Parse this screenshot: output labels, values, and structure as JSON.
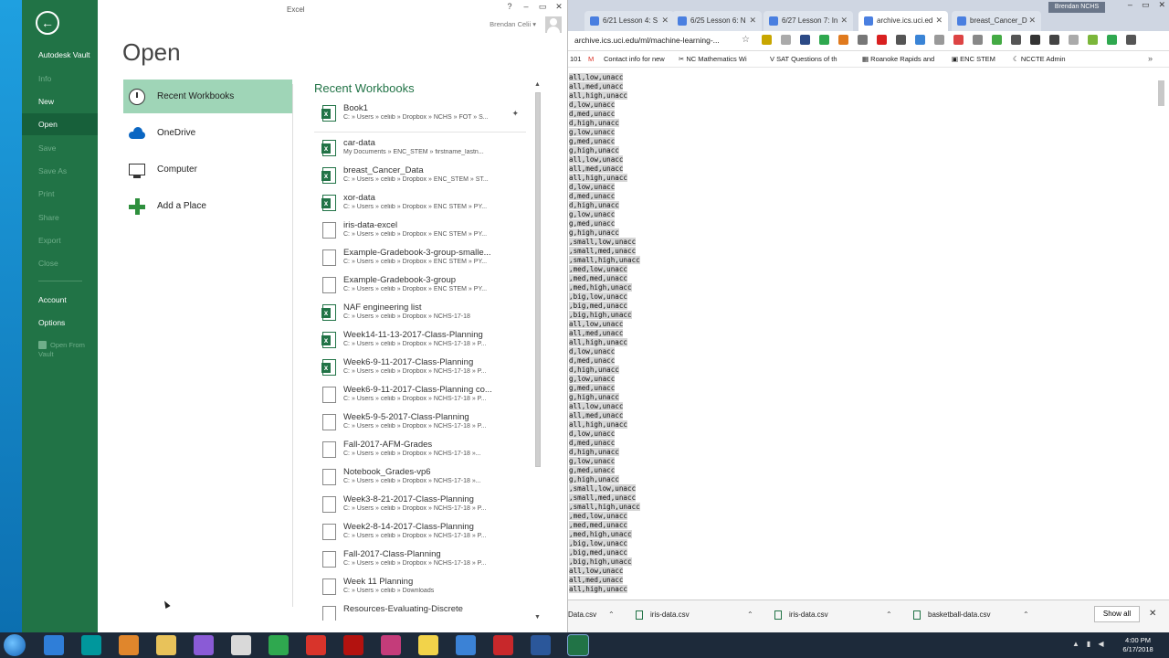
{
  "excel": {
    "title": "Excel",
    "controls": {
      "help": "?",
      "minimize": "–",
      "restore": "▭",
      "close": "✕"
    },
    "user_name": "Brendan Celii ▾",
    "back": "←",
    "nav": {
      "autodesk_vault": "Autodesk Vault",
      "info": "Info",
      "new": "New",
      "open": "Open",
      "save": "Save",
      "save_as": "Save As",
      "print": "Print",
      "share": "Share",
      "export": "Export",
      "close": "Close",
      "account": "Account",
      "options": "Options",
      "open_from_vault": "Open From Vault"
    },
    "page_title": "Open",
    "places": [
      {
        "label": "Recent Workbooks",
        "icon": "clock-icon"
      },
      {
        "label": "OneDrive",
        "icon": "cloud-icon"
      },
      {
        "label": "Computer",
        "icon": "computer-icon"
      },
      {
        "label": "Add a Place",
        "icon": "plus-icon"
      }
    ],
    "recent_title": "Recent Workbooks",
    "pin": "✦",
    "recent_files": [
      {
        "name": "Book1",
        "path": "C: » Users » celiib » Dropbox » NCHS » FOT » S...",
        "icon": "excel-file-icon"
      },
      {
        "name": "car-data",
        "path": "My Documents » ENC_STEM » firstname_lastn...",
        "icon": "excel-file-icon"
      },
      {
        "name": "breast_Cancer_Data",
        "path": "C: » Users » celiib » Dropbox » ENC_STEM » ST...",
        "icon": "excel-file-icon"
      },
      {
        "name": "xor-data",
        "path": "C: » Users » celiib » Dropbox » ENC STEM » PY...",
        "icon": "excel-file-icon"
      },
      {
        "name": "iris-data-excel",
        "path": "C: » Users » celiib » Dropbox » ENC STEM » PY...",
        "icon": "doc-file-icon"
      },
      {
        "name": "Example-Gradebook-3-group-smalle...",
        "path": "C: » Users » celiib » Dropbox » ENC STEM » PY...",
        "icon": "doc-file-icon"
      },
      {
        "name": "Example-Gradebook-3-group",
        "path": "C: » Users » celiib » Dropbox » ENC STEM » PY...",
        "icon": "doc-file-icon"
      },
      {
        "name": "NAF engineering list",
        "path": "C: » Users » celiib » Dropbox » NCHS-17-18",
        "icon": "excel-file-icon"
      },
      {
        "name": "Week14-11-13-2017-Class-Planning",
        "path": "C: » Users » celiib » Dropbox » NCHS-17-18 » P...",
        "icon": "excel-file-icon"
      },
      {
        "name": "Week6-9-11-2017-Class-Planning",
        "path": "C: » Users » celiib » Dropbox » NCHS-17-18 » P...",
        "icon": "excel-file-icon"
      },
      {
        "name": "Week6-9-11-2017-Class-Planning co...",
        "path": "C: » Users » celiib » Dropbox » NCHS-17-18 » P...",
        "icon": "doc-file-icon"
      },
      {
        "name": "Week5-9-5-2017-Class-Planning",
        "path": "C: » Users » celiib » Dropbox » NCHS-17-18 » P...",
        "icon": "doc-file-icon"
      },
      {
        "name": "Fall-2017-AFM-Grades",
        "path": "C: » Users » celiib » Dropbox » NCHS-17-18 »...",
        "icon": "doc-file-icon"
      },
      {
        "name": "Notebook_Grades-vp6",
        "path": "C: » Users » celiib » Dropbox » NCHS-17-18 »...",
        "icon": "doc-file-icon"
      },
      {
        "name": "Week3-8-21-2017-Class-Planning",
        "path": "C: » Users » celiib » Dropbox » NCHS-17-18 » P...",
        "icon": "doc-file-icon"
      },
      {
        "name": "Week2-8-14-2017-Class-Planning",
        "path": "C: » Users » celiib » Dropbox » NCHS-17-18 » P...",
        "icon": "doc-file-icon"
      },
      {
        "name": "Fall-2017-Class-Planning",
        "path": "C: » Users » celiib » Dropbox » NCHS-17-18 » P...",
        "icon": "doc-file-icon"
      },
      {
        "name": "Week 11 Planning",
        "path": "C: » Users » celiib » Downloads",
        "icon": "doc-file-icon"
      },
      {
        "name": "Resources-Evaluating-Discrete",
        "path": "",
        "icon": "doc-file-icon"
      }
    ]
  },
  "chrome": {
    "tabs": [
      {
        "label": "6/21 Lesson 4: S",
        "active": false
      },
      {
        "label": "6/25 Lesson 6: N",
        "active": false
      },
      {
        "label": "6/27 Lesson 7: In",
        "active": false
      },
      {
        "label": "archive.ics.uci.ed",
        "active": true
      },
      {
        "label": "breast_Cancer_D",
        "active": false
      }
    ],
    "profile": "Brendan NCHS",
    "url": "archive.ics.uci.edu/ml/machine-learning-...",
    "bookmarks": {
      "apps": "101",
      "contact": "Contact info for new",
      "ncmath": "NC Mathematics Wi",
      "sat": "SAT Questions of th",
      "roanoke": "Roanoke Rapids and",
      "enc": "ENC STEM",
      "ncccte": "NCCTE Admin",
      "more": "»"
    },
    "lines": [
      "all,low,unacc",
      "all,med,unacc",
      "all,high,unacc",
      "d,low,unacc",
      "d,med,unacc",
      "d,high,unacc",
      "g,low,unacc",
      "g,med,unacc",
      "g,high,unacc",
      "all,low,unacc",
      "all,med,unacc",
      "all,high,unacc",
      "d,low,unacc",
      "d,med,unacc",
      "d,high,unacc",
      "g,low,unacc",
      "g,med,unacc",
      "g,high,unacc",
      ",small,low,unacc",
      ",small,med,unacc",
      ",small,high,unacc",
      ",med,low,unacc",
      ",med,med,unacc",
      ",med,high,unacc",
      ",big,low,unacc",
      ",big,med,unacc",
      ",big,high,unacc",
      "all,low,unacc",
      "all,med,unacc",
      "all,high,unacc",
      "d,low,unacc",
      "d,med,unacc",
      "d,high,unacc",
      "g,low,unacc",
      "g,med,unacc",
      "g,high,unacc",
      "all,low,unacc",
      "all,med,unacc",
      "all,high,unacc",
      "d,low,unacc",
      "d,med,unacc",
      "d,high,unacc",
      "g,low,unacc",
      "g,med,unacc",
      "g,high,unacc",
      ",small,low,unacc",
      ",small,med,unacc",
      ",small,high,unacc",
      ",med,low,unacc",
      ",med,med,unacc",
      ",med,high,unacc",
      ",big,low,unacc",
      ",big,med,unacc",
      ",big,high,unacc",
      "all,low,unacc",
      "all,med,unacc",
      "all,high,unacc"
    ],
    "downloads": [
      {
        "label": "Data.csv"
      },
      {
        "label": "iris-data.csv"
      },
      {
        "label": "iris-data.csv"
      },
      {
        "label": "basketball-data.csv"
      }
    ],
    "show_all": "Show all",
    "close": "✕"
  },
  "taskbar": {
    "time": "4:00 PM",
    "date": "6/17/2018",
    "apps": [
      {
        "name": "ie-icon",
        "color": "#2f7ed8"
      },
      {
        "name": "arduino-icon",
        "color": "#00979c"
      },
      {
        "name": "media-player-icon",
        "color": "#e0862c"
      },
      {
        "name": "file-explorer-icon",
        "color": "#e8c25a"
      },
      {
        "name": "orb-app-icon",
        "color": "#8a5bd6"
      },
      {
        "name": "inkscape-icon",
        "color": "#d9d9d9"
      },
      {
        "name": "chrome-icon",
        "color": "#2fa84f"
      },
      {
        "name": "foxit-icon",
        "color": "#d8342b"
      },
      {
        "name": "ruby-icon",
        "color": "#b3120f"
      },
      {
        "name": "pycharm-icon",
        "color": "#c43c7a"
      },
      {
        "name": "notes-icon",
        "color": "#f2d34a"
      },
      {
        "name": "chrome-2-icon",
        "color": "#3b82d6"
      },
      {
        "name": "target-icon",
        "color": "#c8282b"
      },
      {
        "name": "word-icon",
        "color": "#2b579a"
      },
      {
        "name": "excel-icon",
        "color": "#217346"
      }
    ]
  }
}
